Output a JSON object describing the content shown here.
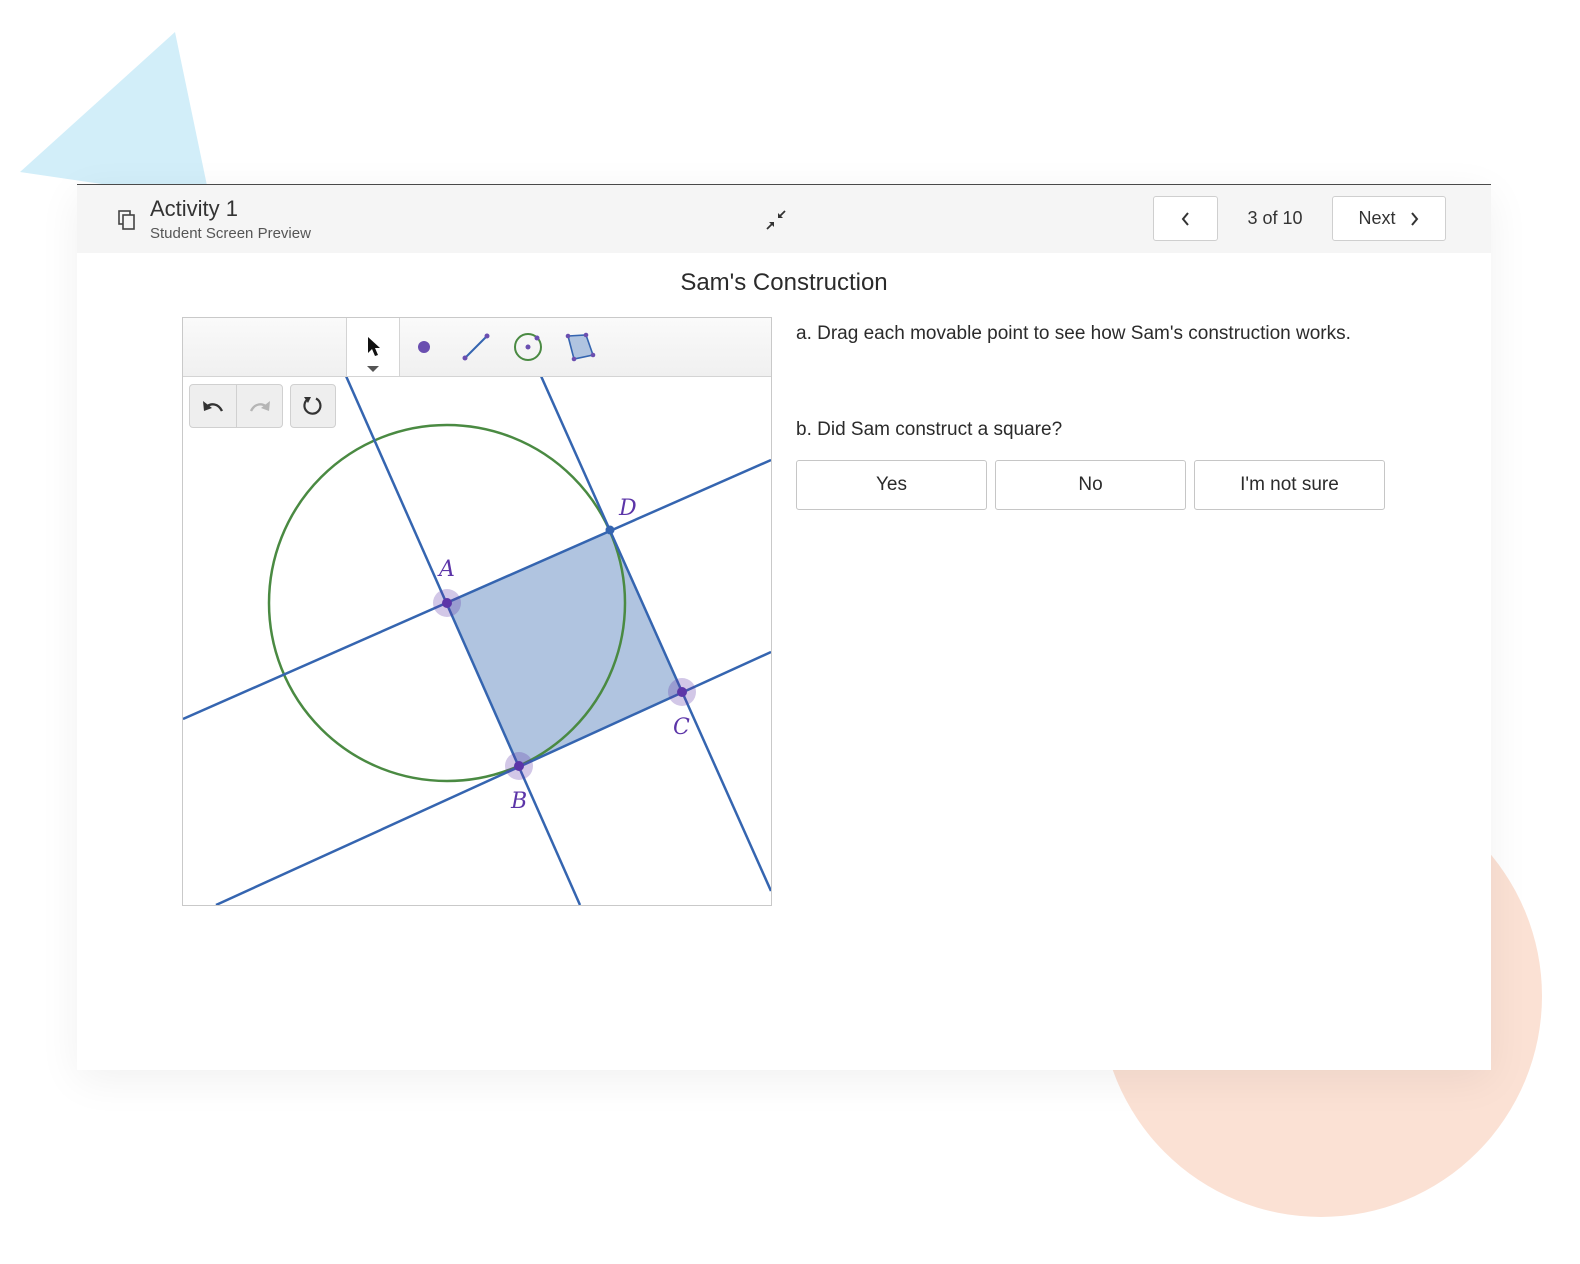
{
  "colors": {
    "triangle": "#d2eef9",
    "circle_bg": "#fbe1d4",
    "line": "#3565b0",
    "circle": "#4a8a42",
    "polygon_fill": "#b0c4e0",
    "point": "#5c35a8"
  },
  "header": {
    "title": "Activity 1",
    "subtitle": "Student Screen Preview",
    "page_count": "3 of 10",
    "next_label": "Next"
  },
  "screen": {
    "title": "Sam's Construction",
    "prompt_a": "a. Drag each movable point to see how Sam's construction works.",
    "prompt_b": "b. Did Sam construct a square?",
    "choices": [
      "Yes",
      "No",
      "I'm not sure"
    ]
  },
  "geometry": {
    "toolbar": [
      "move-tool",
      "point-tool",
      "segment-tool",
      "circle-tool",
      "polygon-tool"
    ],
    "labels": {
      "A": "A",
      "B": "B",
      "C": "C",
      "D": "D"
    }
  }
}
